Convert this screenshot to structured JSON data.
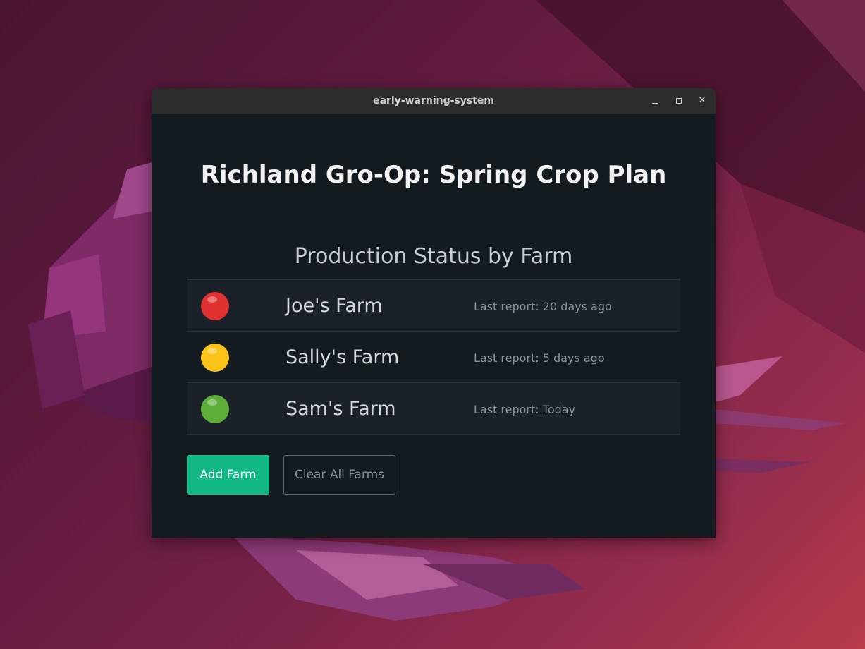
{
  "window": {
    "title": "early-warning-system",
    "minimize_icon": "minimize-icon",
    "maximize_icon": "maximize-icon",
    "close_icon": "close-icon",
    "close_glyph": "✕"
  },
  "app": {
    "title": "Richland Gro-Op: Spring Crop Plan",
    "section_title": "Production Status by Farm"
  },
  "farms": [
    {
      "status": "red",
      "status_color": "#e03131",
      "name": "Joe's Farm",
      "report": "Last report: 20 days ago"
    },
    {
      "status": "yellow",
      "status_color": "#fcc419",
      "name": "Sally's Farm",
      "report": "Last report: 5 days ago"
    },
    {
      "status": "green",
      "status_color": "#5fae3a",
      "name": "Sam's Farm",
      "report": "Last report: Today"
    }
  ],
  "actions": {
    "add_label": "Add Farm",
    "clear_label": "Clear All Farms"
  },
  "colors": {
    "accent": "#12b886",
    "window_bg": "#131a20",
    "titlebar_bg": "#2c2c2c"
  }
}
